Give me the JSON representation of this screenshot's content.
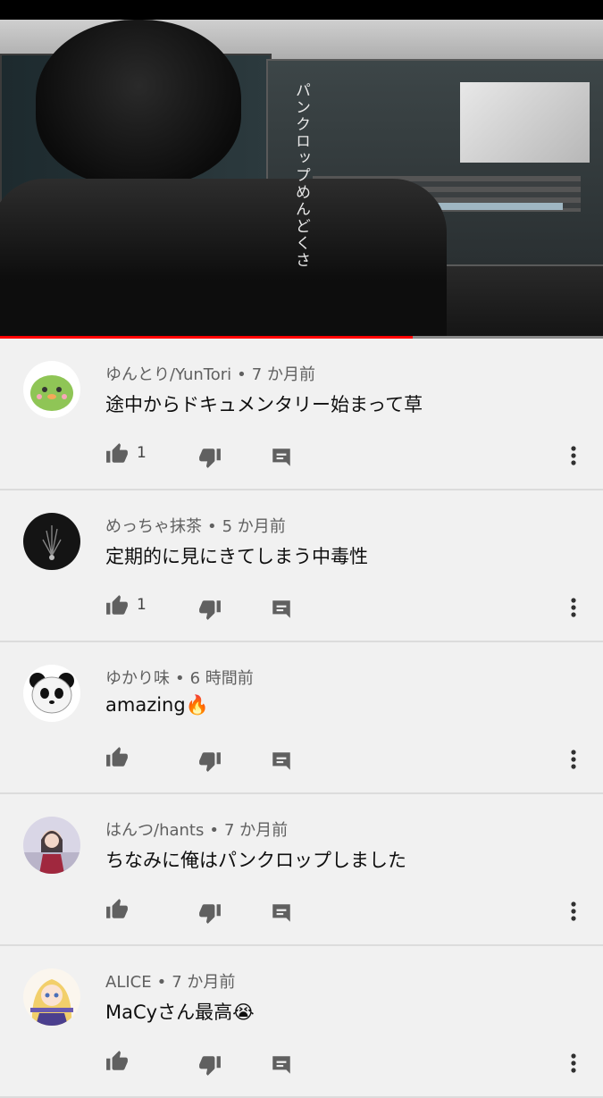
{
  "video": {
    "overlay_text": "パンクロップめんどくさ",
    "progress": 0.685
  },
  "comments": [
    {
      "author": "ゆんとり/YunTori",
      "time": "7 か月前",
      "text": "途中からドキュメンタリー始まって草",
      "likes": "1",
      "avatar": "green-character"
    },
    {
      "author": "めっちゃ抹茶",
      "time": "5 か月前",
      "text": "定期的に見にきてしまう中毒性",
      "likes": "1",
      "avatar": "dark-plant"
    },
    {
      "author": "ゆかり味",
      "time": "6 時間前",
      "text": "amazing🔥",
      "likes": "",
      "avatar": "panda"
    },
    {
      "author": "はんつ/hants",
      "time": "7 か月前",
      "text": "ちなみに俺はパンクロップしました",
      "likes": "",
      "avatar": "photo-person"
    },
    {
      "author": "ALICE",
      "time": "7 か月前",
      "text": "MaCyさん最高😭",
      "likes": "",
      "avatar": "anime-girl"
    }
  ],
  "colors": {
    "accent": "#ff0000",
    "background": "#f1f1f1",
    "meta": "#606060"
  }
}
